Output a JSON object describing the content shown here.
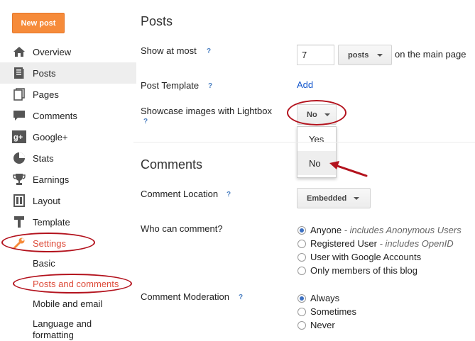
{
  "sidebar": {
    "new_post": "New post",
    "items": [
      {
        "label": "Overview",
        "icon": "home-icon"
      },
      {
        "label": "Posts",
        "icon": "posts-icon"
      },
      {
        "label": "Pages",
        "icon": "pages-icon"
      },
      {
        "label": "Comments",
        "icon": "comments-icon"
      },
      {
        "label": "Google+",
        "icon": "google-plus-icon"
      },
      {
        "label": "Stats",
        "icon": "stats-icon"
      },
      {
        "label": "Earnings",
        "icon": "earnings-icon"
      },
      {
        "label": "Layout",
        "icon": "layout-icon"
      },
      {
        "label": "Template",
        "icon": "template-icon"
      },
      {
        "label": "Settings",
        "icon": "wrench-icon"
      }
    ],
    "sub_items": [
      "Basic",
      "Posts and comments",
      "Mobile and email",
      "Language and",
      "formatting"
    ]
  },
  "posts": {
    "title": "Posts",
    "show_at_most_label": "Show at most",
    "show_at_most_value": "7",
    "unit": "posts",
    "suffix": "on the main page",
    "template_label": "Post Template",
    "template_link": "Add",
    "lightbox_label": "Showcase images with Lightbox",
    "lightbox_value": "No",
    "lightbox_options": [
      "Yes",
      "No"
    ]
  },
  "comments": {
    "title": "Comments",
    "location_label": "Comment Location",
    "location_value": "Embedded",
    "who_label": "Who can comment?",
    "who_options": [
      {
        "label": "Anyone",
        "note": "- includes Anonymous Users"
      },
      {
        "label": "Registered User",
        "note": "- includes OpenID"
      },
      {
        "label": "User with Google Accounts",
        "note": ""
      },
      {
        "label": "Only members of this blog",
        "note": ""
      }
    ],
    "moderation_label": "Comment Moderation",
    "moderation_options": [
      "Always",
      "Sometimes",
      "Never"
    ]
  },
  "help_glyph": "?",
  "colors": {
    "accent": "#f68b3a",
    "settings_text": "#dd4b39",
    "annotation": "#b3121d",
    "link": "#1155cc"
  }
}
